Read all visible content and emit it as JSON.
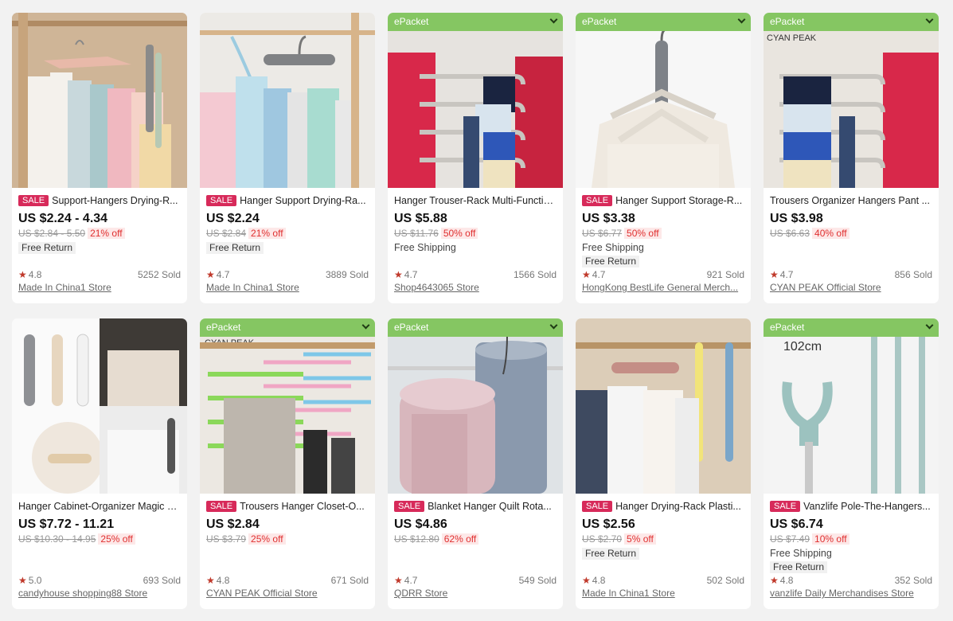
{
  "products": [
    {
      "epacket": false,
      "sale": true,
      "title": "Support-Hangers Drying-R...",
      "price": "US $2.24 - 4.34",
      "orig_price": "US $2.84 - 5.50",
      "off": "21% off",
      "shipping": "",
      "free_return": true,
      "rating": "4.8",
      "sold": "5252 Sold",
      "store": "Made In China1 Store"
    },
    {
      "epacket": false,
      "sale": true,
      "title": "Hanger Support Drying-Ra...",
      "price": "US $2.24",
      "orig_price": "US $2.84",
      "off": "21% off",
      "shipping": "",
      "free_return": true,
      "rating": "4.7",
      "sold": "3889 Sold",
      "store": "Made In China1 Store"
    },
    {
      "epacket": true,
      "sale": false,
      "title": "Hanger Trouser-Rack Multi-Functio...",
      "price": "US $5.88",
      "orig_price": "US $11.76",
      "off": "50% off",
      "shipping": "Free Shipping",
      "free_return": false,
      "rating": "4.7",
      "sold": "1566 Sold",
      "store": "Shop4643065 Store"
    },
    {
      "epacket": true,
      "sale": true,
      "title": "Hanger Support Storage-R...",
      "price": "US $3.38",
      "orig_price": "US $6.77",
      "off": "50% off",
      "shipping": "Free Shipping",
      "free_return": true,
      "rating": "4.7",
      "sold": "921 Sold",
      "store": "HongKong BestLife General Merch..."
    },
    {
      "epacket": true,
      "sale": false,
      "title": "Trousers Organizer Hangers Pant ...",
      "price": "US $3.98",
      "orig_price": "US $6.63",
      "off": "40% off",
      "shipping": "",
      "free_return": false,
      "rating": "4.7",
      "sold": "856 Sold",
      "store": "CYAN PEAK Official Store"
    },
    {
      "epacket": false,
      "sale": false,
      "title": "Hanger Cabinet-Organizer Magic N...",
      "price": "US $7.72 - 11.21",
      "orig_price": "US $10.30 - 14.95",
      "off": "25% off",
      "shipping": "",
      "free_return": false,
      "rating": "5.0",
      "sold": "693 Sold",
      "store": "candyhouse shopping88 Store"
    },
    {
      "epacket": true,
      "sale": true,
      "title": "Trousers Hanger Closet-O...",
      "price": "US $2.84",
      "orig_price": "US $3.79",
      "off": "25% off",
      "shipping": "",
      "free_return": false,
      "rating": "4.8",
      "sold": "671 Sold",
      "store": "CYAN PEAK Official Store"
    },
    {
      "epacket": true,
      "sale": true,
      "title": "Blanket Hanger Quilt Rota...",
      "price": "US $4.86",
      "orig_price": "US $12.80",
      "off": "62% off",
      "shipping": "",
      "free_return": false,
      "rating": "4.7",
      "sold": "549 Sold",
      "store": "QDRR Store"
    },
    {
      "epacket": false,
      "sale": true,
      "title": "Hanger Drying-Rack Plasti...",
      "price": "US $2.56",
      "orig_price": "US $2.70",
      "off": "5% off",
      "shipping": "",
      "free_return": true,
      "rating": "4.8",
      "sold": "502 Sold",
      "store": "Made In China1 Store"
    },
    {
      "epacket": true,
      "sale": true,
      "title": "Vanzlife Pole-The-Hangers...",
      "price": "US $6.74",
      "orig_price": "US $7.49",
      "off": "10% off",
      "shipping": "Free Shipping",
      "free_return": true,
      "rating": "4.8",
      "sold": "352 Sold",
      "store": "vanzlife Daily Merchandises Store"
    }
  ],
  "labels": {
    "epacket": "ePacket",
    "sale": "SALE",
    "free_return": "Free Return",
    "star": "★"
  },
  "image_text": {
    "cyan_peak": "CYAN PEAK",
    "size_102cm": "102cm"
  }
}
